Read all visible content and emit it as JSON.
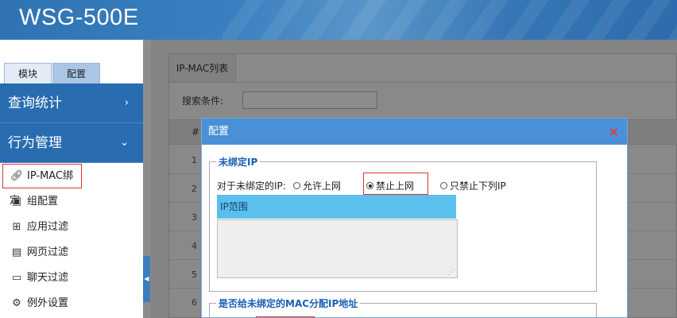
{
  "app": {
    "title": "WSG-500E"
  },
  "sidebar": {
    "tabs": [
      {
        "label": "模块"
      },
      {
        "label": "配置"
      }
    ],
    "groups": [
      {
        "label": "查询统计",
        "chevron": "›"
      },
      {
        "label": "行为管理",
        "chevron": "⌄"
      }
    ],
    "items": [
      {
        "label": "IP-MAC绑定",
        "icon": "link-icon"
      },
      {
        "label": "组配置",
        "icon": "id-card-icon"
      },
      {
        "label": "应用过滤",
        "icon": "grid-icon"
      },
      {
        "label": "网页过滤",
        "icon": "page-icon"
      },
      {
        "label": "聊天过滤",
        "icon": "chat-icon"
      },
      {
        "label": "例外设置",
        "icon": "gear-icon"
      }
    ]
  },
  "main": {
    "tab_label": "IP-MAC列表",
    "search_label": "搜索条件:",
    "table": {
      "header_hash": "#",
      "rows": [
        "1",
        "2",
        "3",
        "4",
        "5",
        "6"
      ]
    }
  },
  "modal": {
    "title": "配置",
    "close": "×",
    "section1": {
      "legend": "未绑定IP",
      "option_label": "对于未绑定的IP:",
      "options": [
        {
          "label": "允许上网",
          "selected": false
        },
        {
          "label": "禁止上网",
          "selected": true
        },
        {
          "label": "只禁止下列IP",
          "selected": false
        }
      ],
      "ip_range_header": "IP范围"
    },
    "section2": {
      "legend": "是否给未绑定的MAC分配IP地址"
    }
  },
  "colors": {
    "header": "#2f73b3",
    "sidebar": "#2a6cb0",
    "modal_header": "#4a90d6",
    "ip_range_header": "#5bc0ec",
    "highlight": "#dd3333"
  }
}
